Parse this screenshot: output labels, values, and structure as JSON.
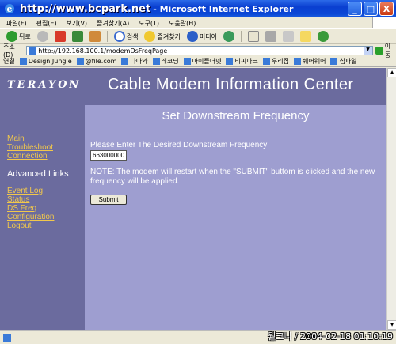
{
  "window": {
    "title_url": "http://www.bcpark.net",
    "title_rest": "- Microsoft Internet Explorer",
    "minimize": "_",
    "maximize": "□",
    "close": "X"
  },
  "menubar": {
    "items": [
      "파일(F)",
      "편집(E)",
      "보기(V)",
      "즐겨찾기(A)",
      "도구(T)",
      "도움말(H)"
    ]
  },
  "toolbar": {
    "back": "뒤로",
    "search": "검색",
    "favorites": "즐겨찾기",
    "media": "미디어"
  },
  "addressbar": {
    "label": "주소(D)",
    "url": "http://192.168.100.1/modemDsFreqPage",
    "go": "이동"
  },
  "linksbar": {
    "label": "연결",
    "items": [
      "Design Jungle",
      "@file.com",
      "다나와",
      "레코딩",
      "마이플더넷",
      "비씨파크",
      "우리집",
      "쉐어웨어",
      "심파일"
    ]
  },
  "page": {
    "logo": "TERAYON",
    "header_title": "Cable Modem Information Center",
    "sidebar": {
      "links_top": [
        "Main",
        "Troubleshoot",
        "Connection"
      ],
      "heading": "Advanced Links",
      "links_bottom": [
        "Event Log",
        "Status",
        "DS Freq",
        "Configuration",
        "Logout"
      ]
    },
    "main": {
      "title": "Set Downstream Frequency",
      "prompt": "Please Enter The Desired Downstream Frequency",
      "freq_value": "663000000",
      "note": "NOTE: The modem will restart when the \"SUBMIT\" buttom is clicked and the new frequency will be applied.",
      "submit": "Submit"
    }
  },
  "statusbar": {
    "stamp": "월크니 / 2004-02-18 01:10:19"
  }
}
